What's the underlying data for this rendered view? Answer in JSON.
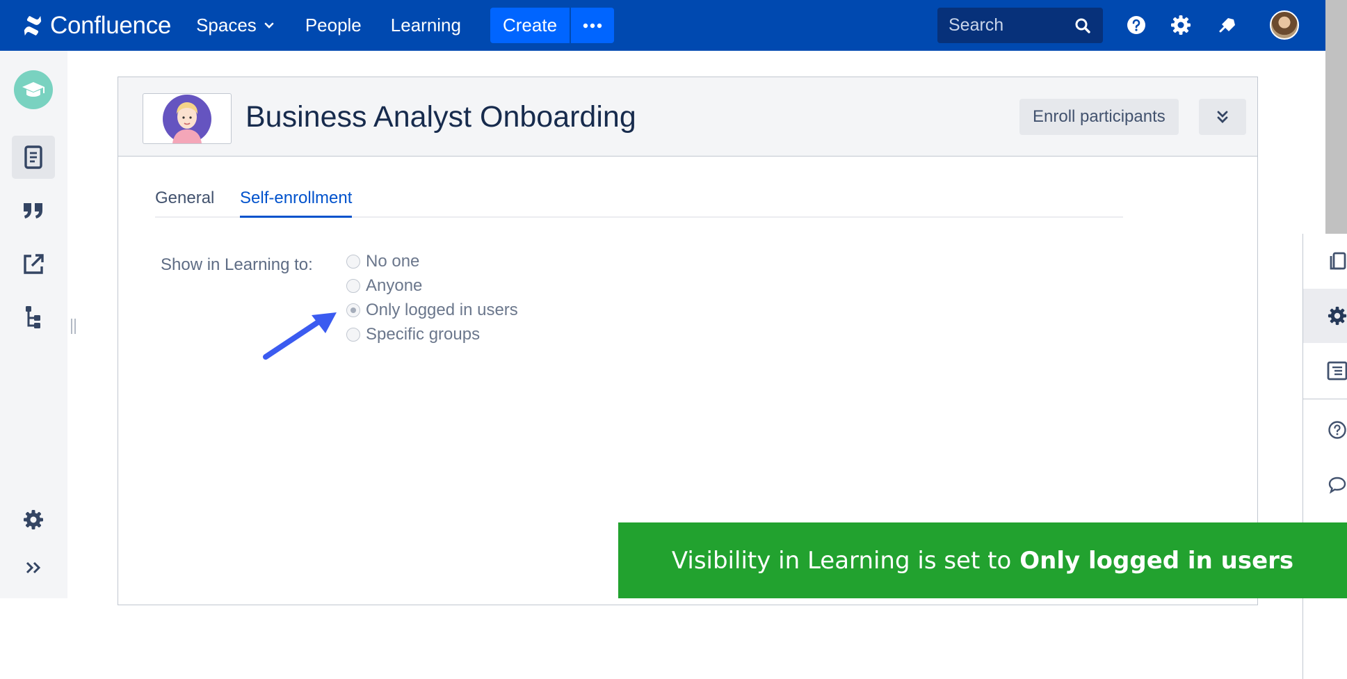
{
  "nav": {
    "brand": "Confluence",
    "spaces": "Spaces",
    "people": "People",
    "learning": "Learning",
    "create": "Create",
    "search_placeholder": "Search"
  },
  "course": {
    "title": "Business Analyst Onboarding",
    "enroll_label": "Enroll participants"
  },
  "tabs": [
    {
      "label": "General",
      "selected": false
    },
    {
      "label": "Self-enrollment",
      "selected": true
    }
  ],
  "visibility": {
    "label": "Show in Learning to:",
    "options": [
      {
        "label": "No one",
        "checked": false
      },
      {
        "label": "Anyone",
        "checked": false
      },
      {
        "label": "Only logged in users",
        "checked": true
      },
      {
        "label": "Specific groups",
        "checked": false
      }
    ]
  },
  "banner": {
    "prefix": "Visibility in Learning is set to",
    "highlight": "Only logged in users"
  },
  "colors": {
    "nav_bg": "#0049b0",
    "create_button": "#0065ff",
    "selected_tab": "#0052cc",
    "banner_bg": "#22a22f",
    "arrow": "#3b5bf0"
  },
  "icons": {
    "sidebar": [
      "graduation-cap-icon",
      "pages-icon",
      "quote-icon",
      "external-link-icon",
      "tree-icon",
      "gear-icon",
      "expand-icon"
    ],
    "rail": [
      "copy-icon",
      "gear-icon",
      "table-of-contents-icon",
      "help-icon",
      "comment-icon"
    ],
    "top": [
      "search-icon",
      "help-icon",
      "gear-icon",
      "notifications-icon"
    ]
  }
}
